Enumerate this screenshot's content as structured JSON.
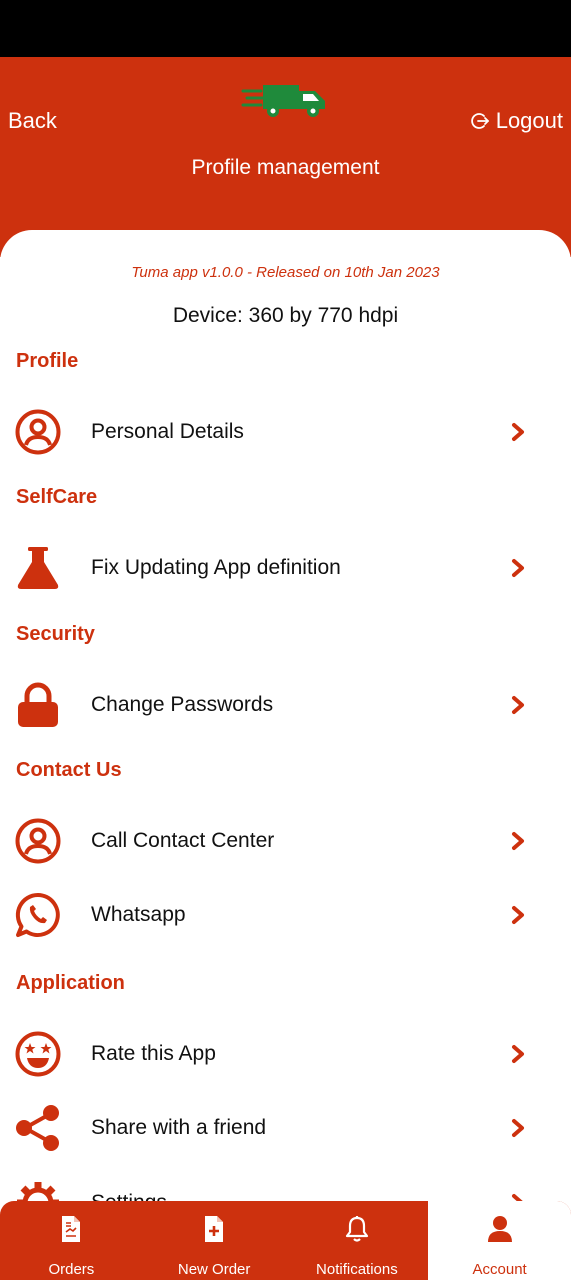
{
  "header": {
    "back_label": "Back",
    "logout_label": "Logout",
    "title": "Profile management"
  },
  "info": {
    "version": "Tuma app v1.0.0 - Released on 10th Jan 2023",
    "device": "Device: 360 by 770 hdpi"
  },
  "sections": {
    "profile": "Profile",
    "selfcare": "SelfCare",
    "security": "Security",
    "contact": "Contact Us",
    "application": "Application"
  },
  "items": {
    "personal_details": "Personal Details",
    "fix_updating": "Fix Updating App definition",
    "change_passwords": "Change Passwords",
    "call_center": "Call Contact Center",
    "whatsapp": "Whatsapp",
    "rate_app": "Rate this App",
    "share": "Share with a friend",
    "settings": "Settings"
  },
  "nav": {
    "orders": "Orders",
    "new_order": "New Order",
    "notifications": "Notifications",
    "account": "Account",
    "active": "Account"
  },
  "colors": {
    "brand": "#cd310e",
    "truck": "#1f8a3b"
  }
}
